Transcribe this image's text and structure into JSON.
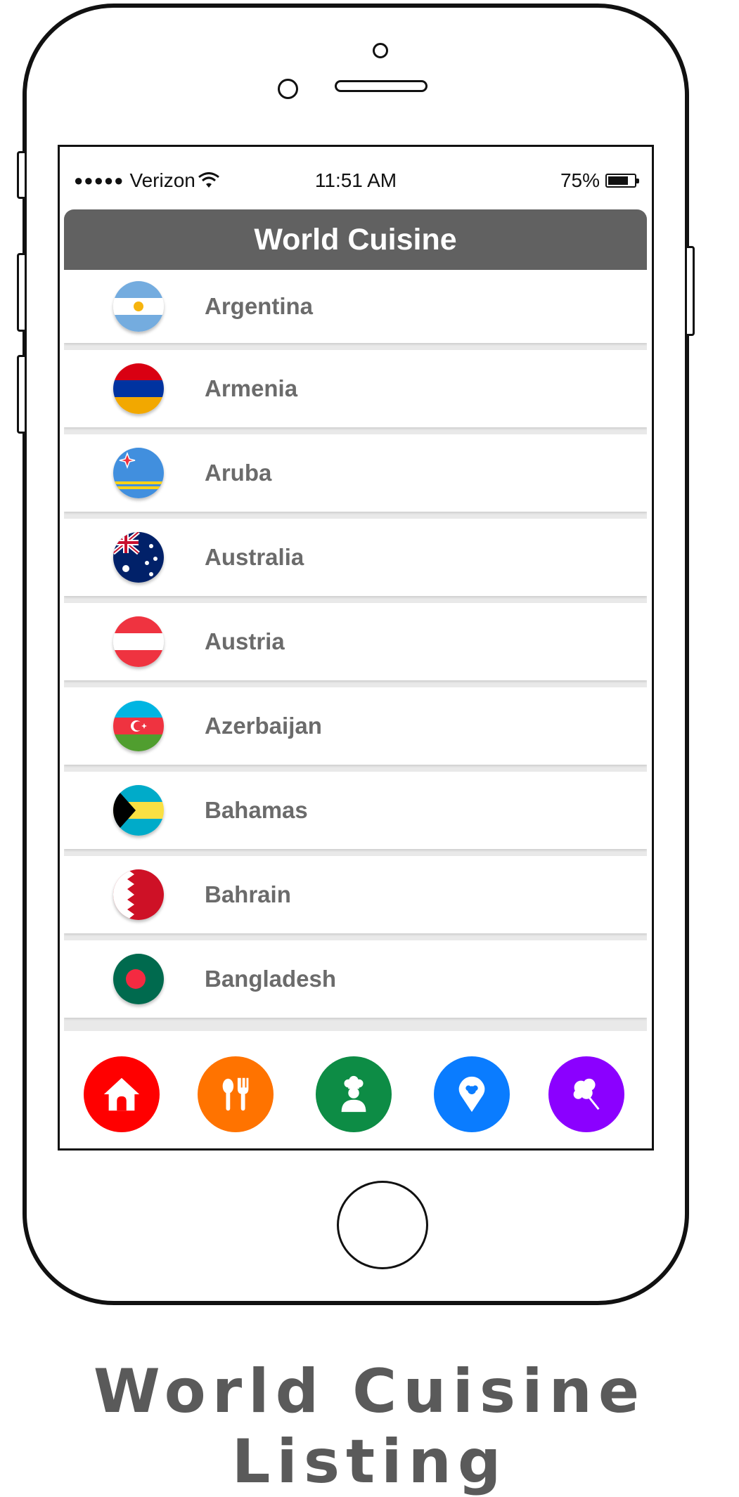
{
  "status_bar": {
    "carrier": "Verizon",
    "signal_dots": "●●●●●",
    "time": "11:51 AM",
    "battery": "75%"
  },
  "app": {
    "title": "World Cuisine"
  },
  "countries": [
    {
      "name": "Argentina",
      "flag": "argentina-flag-icon"
    },
    {
      "name": "Armenia",
      "flag": "armenia-flag-icon"
    },
    {
      "name": "Aruba",
      "flag": "aruba-flag-icon"
    },
    {
      "name": "Australia",
      "flag": "australia-flag-icon"
    },
    {
      "name": "Austria",
      "flag": "austria-flag-icon"
    },
    {
      "name": "Azerbaijan",
      "flag": "azerbaijan-flag-icon"
    },
    {
      "name": "Bahamas",
      "flag": "bahamas-flag-icon"
    },
    {
      "name": "Bahrain",
      "flag": "bahrain-flag-icon"
    },
    {
      "name": "Bangladesh",
      "flag": "bangladesh-flag-icon"
    }
  ],
  "tabs": [
    {
      "icon": "home-icon",
      "color": "#ff0000"
    },
    {
      "icon": "utensils-icon",
      "color": "#ff7300"
    },
    {
      "icon": "chef-icon",
      "color": "#0d8c45"
    },
    {
      "icon": "location-pin-icon",
      "color": "#0a7cff"
    },
    {
      "icon": "ice-cream-icon",
      "color": "#8b00ff"
    }
  ],
  "caption": "World Cuisine Listing"
}
